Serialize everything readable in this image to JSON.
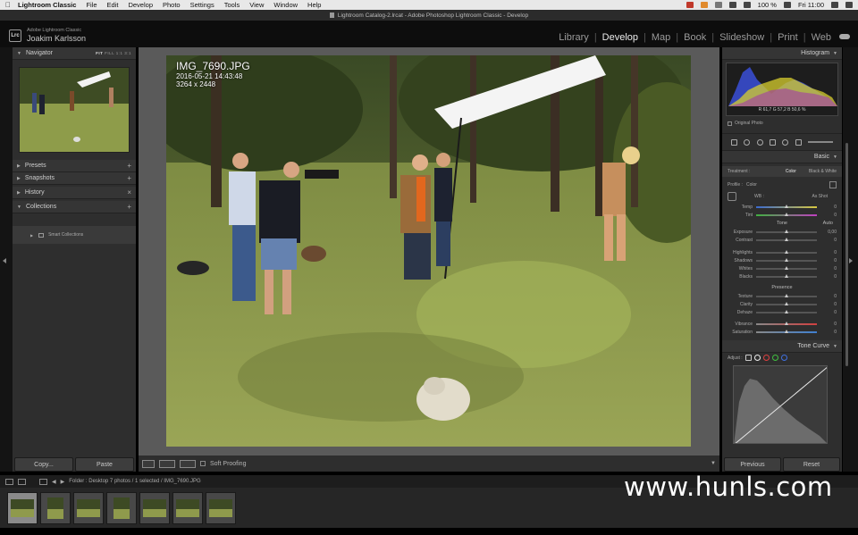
{
  "menubar": {
    "app": "Lightroom Classic",
    "items": [
      "File",
      "Edit",
      "Develop",
      "Photo",
      "Settings",
      "Tools",
      "View",
      "Window",
      "Help"
    ],
    "battery": "100 %",
    "clock": "Fri 11:00"
  },
  "window": {
    "title": "Lightroom Catalog-2.lrcat - Adobe Photoshop Lightroom Classic - Develop"
  },
  "identity": {
    "badge": "Lrc",
    "app_small": "Adobe Lightroom Classic",
    "user": "Joakim Karlsson"
  },
  "modules": [
    "Library",
    "Develop",
    "Map",
    "Book",
    "Slideshow",
    "Print",
    "Web"
  ],
  "left_panel": {
    "navigator": {
      "title": "Navigator",
      "zoom_fit": "FIT",
      "zoom_other": "FILL  1:1  3:1"
    },
    "presets": "Presets",
    "snapshots": "Snapshots",
    "history": "History",
    "collections": "Collections",
    "smart_collections": "Smart Collections",
    "copy": "Copy...",
    "paste": "Paste"
  },
  "photo": {
    "filename": "IMG_7690.JPG",
    "date": "2016-05-21 14:43:48",
    "dims": "3264 x 2448"
  },
  "toolbar": {
    "soft_proofing": "Soft Proofing"
  },
  "right_panel": {
    "histogram_title": "Histogram",
    "hist_values": "R  61,7  G  57,2  B  50,6 %",
    "original_photo": "Original Photo",
    "basic_title": "Basic",
    "treatment_label": "Treatment :",
    "treatment_color": "Color",
    "treatment_bw": "Black & White",
    "profile_label": "Profile :",
    "profile_value": "Color",
    "wb_label": "WB :",
    "wb_value": "As Shot",
    "temp_tint": [
      {
        "label": "Temp",
        "value": "0",
        "pos": 0.5
      },
      {
        "label": "Tint",
        "value": "0",
        "pos": 0.5
      }
    ],
    "tone_title": "Tone",
    "tone_auto": "Auto",
    "tone": [
      {
        "label": "Exposure",
        "value": "0,00",
        "pos": 0.5
      },
      {
        "label": "Contrast",
        "value": "0",
        "pos": 0.5
      }
    ],
    "tone2": [
      {
        "label": "Highlights",
        "value": "0",
        "pos": 0.5
      },
      {
        "label": "Shadows",
        "value": "0",
        "pos": 0.5
      },
      {
        "label": "Whites",
        "value": "0",
        "pos": 0.5
      },
      {
        "label": "Blacks",
        "value": "0",
        "pos": 0.5
      }
    ],
    "presence_title": "Presence",
    "presence": [
      {
        "label": "Texture",
        "value": "0",
        "pos": 0.5
      },
      {
        "label": "Clarity",
        "value": "0",
        "pos": 0.5
      },
      {
        "label": "Dehaze",
        "value": "0",
        "pos": 0.5
      }
    ],
    "presence2": [
      {
        "label": "Vibrance",
        "value": "0",
        "pos": 0.5
      },
      {
        "label": "Saturation",
        "value": "0",
        "pos": 0.5
      }
    ],
    "tone_curve_title": "Tone Curve",
    "adjust_label": "Adjust :",
    "previous": "Previous",
    "reset": "Reset"
  },
  "filmstrip": {
    "info": "Folder : Desktop     7 photos / 1 selected / IMG_7690.JPG",
    "thumbs": [
      {
        "portrait": false,
        "selected": true
      },
      {
        "portrait": true,
        "selected": false
      },
      {
        "portrait": false,
        "selected": false
      },
      {
        "portrait": true,
        "selected": false
      },
      {
        "portrait": false,
        "selected": false
      },
      {
        "portrait": false,
        "selected": false
      },
      {
        "portrait": false,
        "selected": false
      }
    ]
  },
  "watermark": "www.hunls.com"
}
